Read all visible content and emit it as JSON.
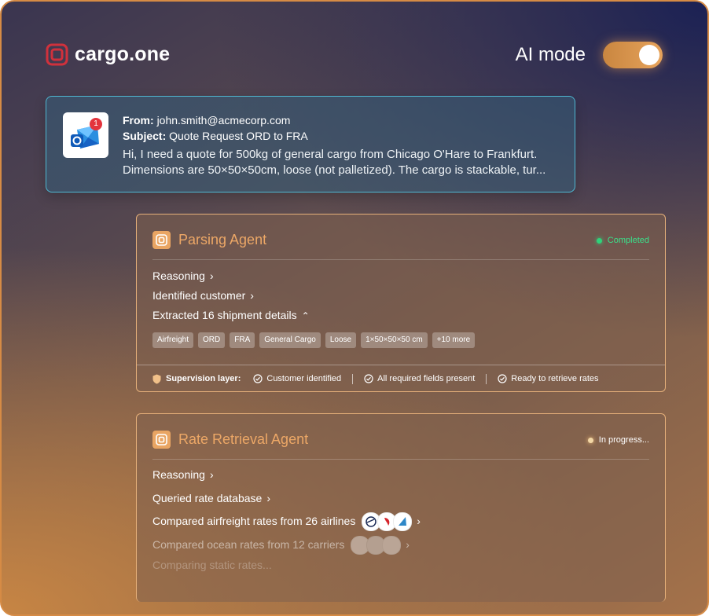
{
  "brand": {
    "name": "cargo.one",
    "color": "#d0313c"
  },
  "ai_mode": {
    "label": "AI mode",
    "enabled": true
  },
  "email": {
    "from_label": "From:",
    "from": "john.smith@acmecorp.com",
    "subject_label": "Subject:",
    "subject": "Quote Request ORD to FRA",
    "badge_count": "1",
    "message": "Hi, I need a quote for 500kg of general cargo from Chicago O'Hare to Frankfurt. Dimensions are 50×50×50cm, loose (not palletized). The cargo is stackable, tur..."
  },
  "parsing_agent": {
    "title": "Parsing Agent",
    "status": "Completed",
    "status_color": "#2fd27a",
    "rows": [
      "Reasoning",
      "Identified customer",
      "Extracted 16 shipment details"
    ],
    "chips": [
      "Airfreight",
      "ORD",
      "FRA",
      "General Cargo",
      "Loose",
      "1×50×50×50 cm",
      "+10 more"
    ],
    "supervision": {
      "title": "Supervision layer:",
      "items": [
        "Customer identified",
        "All required fields present",
        "Ready to retrieve rates"
      ]
    }
  },
  "rate_agent": {
    "title": "Rate Retrieval Agent",
    "status": "In progress...",
    "status_color": "#f3d7a6",
    "rows": [
      "Reasoning",
      "Queried rate database",
      "Compared airfreight rates from 26 airlines",
      "Compared ocean rates from 12 carriers",
      "Comparing static rates..."
    ]
  }
}
